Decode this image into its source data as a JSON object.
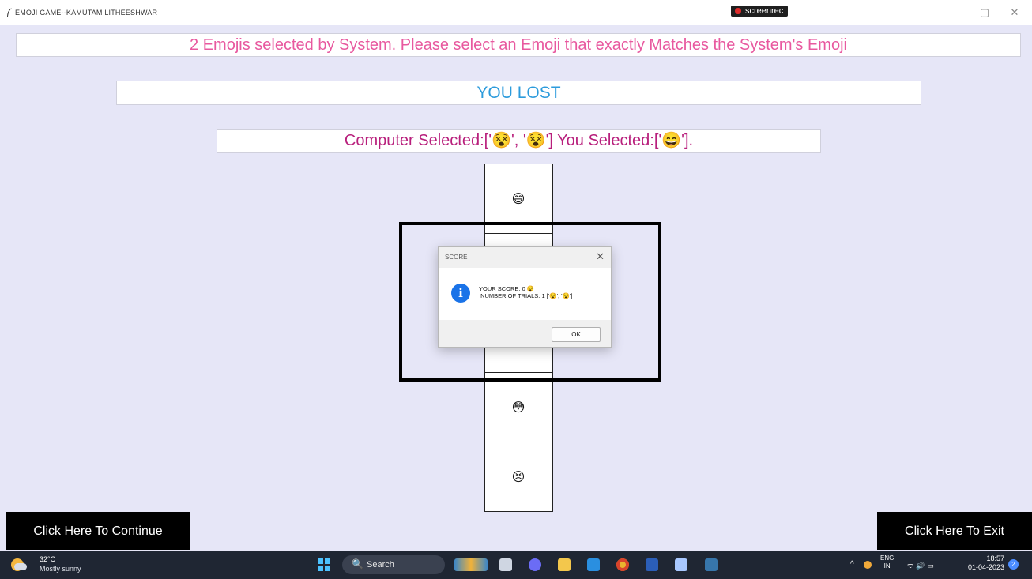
{
  "window": {
    "title": "EMOJI GAME--KAMUTAM LITHEESHWAR",
    "recorder_label": "screenrec",
    "controls": [
      "–",
      "▢",
      "✕"
    ]
  },
  "game": {
    "instruction": "2 Emojis selected by System. Please select an Emoji that exactly Matches the System's Emoji",
    "status": "YOU LOST",
    "result": "Computer Selected:['😵', '😵'] You Selected:['😄'].",
    "emoji_options": [
      "😄",
      "",
      "",
      "",
      "😳",
      "😣"
    ],
    "continue_button": "Click Here To Continue",
    "exit_button": "Click Here To Exit"
  },
  "dialog": {
    "title": "SCORE",
    "close": "✕",
    "info_icon": "i",
    "message": "YOUR SCORE: 0 😵\n NUMBER OF TRIALS: 1 ['😵', '😵']",
    "ok_label": "OK"
  },
  "taskbar": {
    "weather_temp": "32°C",
    "weather_condition": "Mostly sunny",
    "search_label": "Search",
    "search_icon": "🔍",
    "tray_chevron": "^",
    "lang_line1": "ENG",
    "lang_line2": "IN",
    "tray_icons": "ᯤ 🔊 ▭",
    "time": "18:57",
    "date": "01-04-2023",
    "notification_count": "2"
  },
  "colors": {
    "instruction": "#e8599f",
    "status": "#2c9bdc",
    "result": "#b81f7c",
    "background": "#e6e6f7",
    "taskbar": "#1f2633"
  }
}
